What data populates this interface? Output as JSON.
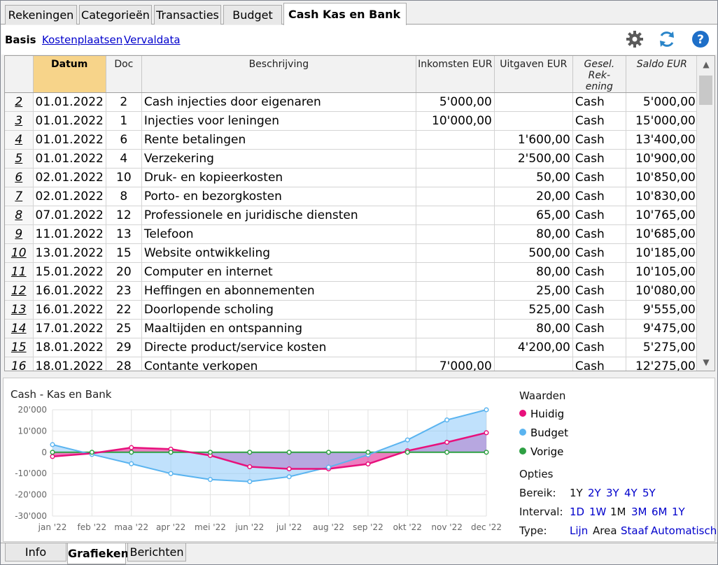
{
  "tabs": [
    {
      "label": "Rekeningen"
    },
    {
      "label": "Categorieën"
    },
    {
      "label": "Transacties"
    },
    {
      "label": "Budget"
    },
    {
      "label": "Cash Kas en Bank",
      "active": true
    }
  ],
  "subbar": {
    "basis": "Basis",
    "links": [
      "Kostenplaatsen",
      "Vervaldata"
    ]
  },
  "table": {
    "headers": {
      "datum": "Datum",
      "doc": "Doc",
      "beschrijving": "Beschrijving",
      "inkomsten": "Inkomsten EUR",
      "uitgaven": "Uitgaven EUR",
      "gesel_line1": "Gesel. Rek-",
      "gesel_line2": "ening",
      "saldo": "Saldo EUR"
    },
    "rows": [
      {
        "n": "2",
        "datum": "01.01.2022",
        "doc": "2",
        "desc": "Cash injecties door eigenaren",
        "in": "5'000,00",
        "out": "",
        "acc": "Cash",
        "saldo": "5'000,00"
      },
      {
        "n": "3",
        "datum": "01.01.2022",
        "doc": "1",
        "desc": "Injecties voor leningen",
        "in": "10'000,00",
        "out": "",
        "acc": "Cash",
        "saldo": "15'000,00"
      },
      {
        "n": "4",
        "datum": "01.01.2022",
        "doc": "6",
        "desc": "Rente betalingen",
        "in": "",
        "out": "1'600,00",
        "acc": "Cash",
        "saldo": "13'400,00"
      },
      {
        "n": "5",
        "datum": "01.01.2022",
        "doc": "4",
        "desc": "Verzekering",
        "in": "",
        "out": "2'500,00",
        "acc": "Cash",
        "saldo": "10'900,00"
      },
      {
        "n": "6",
        "datum": "02.01.2022",
        "doc": "10",
        "desc": "Druk- en kopieerkosten",
        "in": "",
        "out": "50,00",
        "acc": "Cash",
        "saldo": "10'850,00"
      },
      {
        "n": "7",
        "datum": "02.01.2022",
        "doc": "8",
        "desc": "Porto- en bezorgkosten",
        "in": "",
        "out": "20,00",
        "acc": "Cash",
        "saldo": "10'830,00"
      },
      {
        "n": "8",
        "datum": "07.01.2022",
        "doc": "12",
        "desc": "Professionele en juridische diensten",
        "in": "",
        "out": "65,00",
        "acc": "Cash",
        "saldo": "10'765,00"
      },
      {
        "n": "9",
        "datum": "11.01.2022",
        "doc": "13",
        "desc": "Telefoon",
        "in": "",
        "out": "80,00",
        "acc": "Cash",
        "saldo": "10'685,00"
      },
      {
        "n": "10",
        "datum": "13.01.2022",
        "doc": "15",
        "desc": "Website ontwikkeling",
        "in": "",
        "out": "500,00",
        "acc": "Cash",
        "saldo": "10'185,00"
      },
      {
        "n": "11",
        "datum": "15.01.2022",
        "doc": "20",
        "desc": "Computer en internet",
        "in": "",
        "out": "80,00",
        "acc": "Cash",
        "saldo": "10'105,00"
      },
      {
        "n": "12",
        "datum": "16.01.2022",
        "doc": "23",
        "desc": "Heffingen en abonnementen",
        "in": "",
        "out": "25,00",
        "acc": "Cash",
        "saldo": "10'080,00"
      },
      {
        "n": "13",
        "datum": "16.01.2022",
        "doc": "22",
        "desc": "Doorlopende scholing",
        "in": "",
        "out": "525,00",
        "acc": "Cash",
        "saldo": "9'555,00"
      },
      {
        "n": "14",
        "datum": "17.01.2022",
        "doc": "25",
        "desc": "Maaltijden en ontspanning",
        "in": "",
        "out": "80,00",
        "acc": "Cash",
        "saldo": "9'475,00"
      },
      {
        "n": "15",
        "datum": "18.01.2022",
        "doc": "29",
        "desc": "Directe product/service kosten",
        "in": "",
        "out": "4'200,00",
        "acc": "Cash",
        "saldo": "5'275,00"
      },
      {
        "n": "16",
        "datum": "18.01.2022",
        "doc": "28",
        "desc": "Contante verkopen",
        "in": "7'000,00",
        "out": "",
        "acc": "Cash",
        "saldo": "12'275,00"
      }
    ]
  },
  "chart_data": {
    "type": "area",
    "title": "Cash - Kas en Bank",
    "categories": [
      "jan '22",
      "feb '22",
      "maa '22",
      "apr '22",
      "mei '22",
      "jun '22",
      "jul '22",
      "aug '22",
      "sep '22",
      "okt '22",
      "nov '22",
      "dec '22"
    ],
    "y_ticks": [
      "20'000",
      "10'000",
      "0",
      "-10'000",
      "-20'000",
      "-30'000"
    ],
    "ylim": [
      -30000,
      20000
    ],
    "grid": true,
    "series": [
      {
        "name": "Huidig",
        "color": "#e8107c",
        "values": [
          -2000,
          -500,
          2200,
          1500,
          -1500,
          -6800,
          -7800,
          -7800,
          -5500,
          700,
          4700,
          9200
        ]
      },
      {
        "name": "Budget",
        "color": "#5ab4f0",
        "values": [
          3600,
          -1000,
          -5400,
          -10000,
          -12800,
          -13800,
          -11500,
          -7000,
          -1200,
          5800,
          15200,
          20000
        ]
      },
      {
        "name": "Vorige",
        "color": "#2ea043",
        "values": [
          0,
          0,
          0,
          0,
          0,
          0,
          0,
          0,
          0,
          0,
          0,
          0
        ]
      }
    ]
  },
  "side": {
    "waarden_label": "Waarden",
    "opties_label": "Opties",
    "bereik_label": "Bereik:",
    "bereik_options": [
      "1Y",
      "2Y",
      "3Y",
      "4Y",
      "5Y"
    ],
    "bereik_selected": "1Y",
    "interval_label": "Interval:",
    "interval_options": [
      "1D",
      "1W",
      "1M",
      "3M",
      "6M",
      "1Y"
    ],
    "interval_selected": "1M",
    "type_label": "Type:",
    "type_options": [
      "Lijn",
      "Area",
      "Staaf",
      "Automatisch"
    ],
    "type_selected": "Area"
  },
  "bottom_tabs": [
    {
      "label": "Info"
    },
    {
      "label": "Grafieken",
      "active": true
    },
    {
      "label": "Berichten"
    }
  ]
}
